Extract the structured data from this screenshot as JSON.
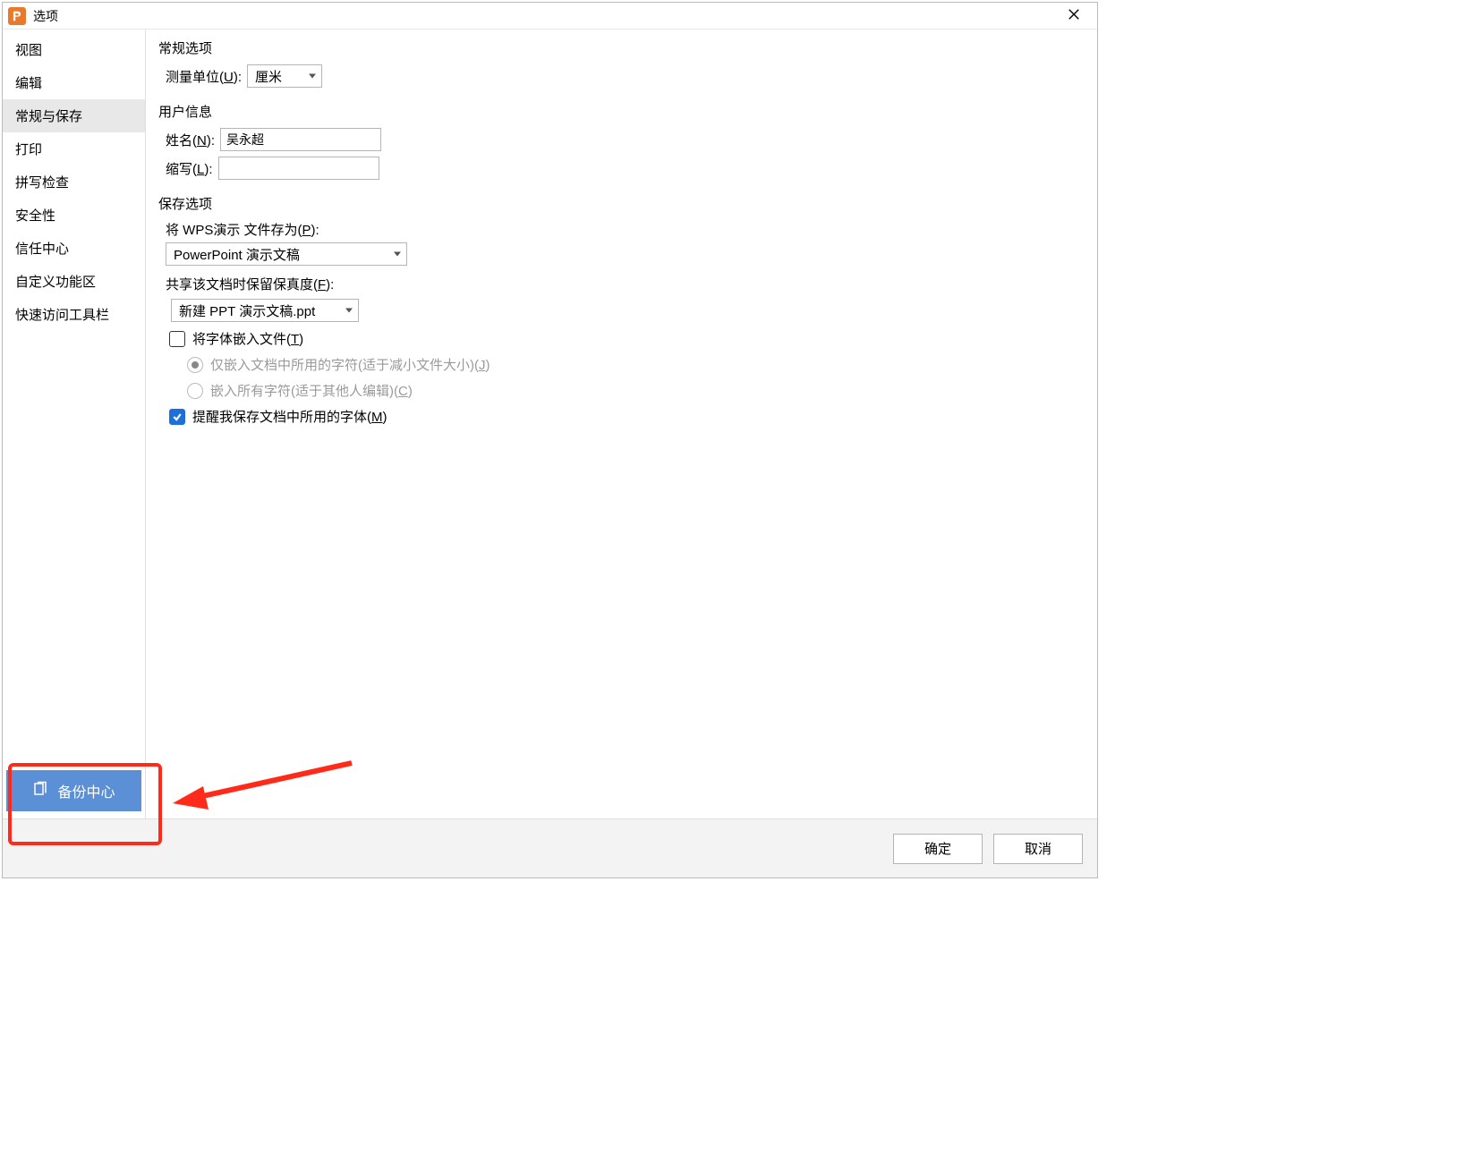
{
  "window": {
    "title": "选项"
  },
  "sidebar": {
    "items": [
      {
        "label": "视图"
      },
      {
        "label": "编辑"
      },
      {
        "label": "常规与保存",
        "selected": true
      },
      {
        "label": "打印"
      },
      {
        "label": "拼写检查"
      },
      {
        "label": "安全性"
      },
      {
        "label": "信任中心"
      },
      {
        "label": "自定义功能区"
      },
      {
        "label": "快速访问工具栏"
      }
    ],
    "backup_label": "备份中心"
  },
  "sections": {
    "general": {
      "legend": "常规选项",
      "unit_label_pre": "测量单位(",
      "unit_label_key": "U",
      "unit_label_post": "):",
      "unit_value": "厘米"
    },
    "user": {
      "legend": "用户信息",
      "name_label_pre": "姓名(",
      "name_label_key": "N",
      "name_label_post": "):",
      "name_value": "吴永超",
      "initials_label_pre": "缩写(",
      "initials_label_key": "L",
      "initials_label_post": "):",
      "initials_value": ""
    },
    "save": {
      "legend": "保存选项",
      "saveas_label_pre": "将 WPS演示 文件存为(",
      "saveas_label_key": "P",
      "saveas_label_post": "):",
      "saveas_value": "PowerPoint 演示文稿",
      "fidelity_label_pre": "共享该文档时保留保真度(",
      "fidelity_label_key": "F",
      "fidelity_label_post": "):",
      "fidelity_value": "新建 PPT 演示文稿.ppt",
      "embed_fonts_label_pre": "将字体嵌入文件(",
      "embed_fonts_label_key": "T",
      "embed_fonts_label_post": ")",
      "embed_fonts_checked": false,
      "embed_only_used_label_pre": "仅嵌入文档中所用的字符(适于减小文件大小)(",
      "embed_only_used_label_key": "J",
      "embed_only_used_label_post": ")",
      "embed_only_used_selected": true,
      "embed_all_label_pre": "嵌入所有字符(适于其他人编辑)(",
      "embed_all_label_key": "C",
      "embed_all_label_post": ")",
      "embed_all_selected": false,
      "remind_fonts_label_pre": "提醒我保存文档中所用的字体(",
      "remind_fonts_label_key": "M",
      "remind_fonts_label_post": ")",
      "remind_fonts_checked": true
    }
  },
  "footer": {
    "ok": "确定",
    "cancel": "取消"
  }
}
